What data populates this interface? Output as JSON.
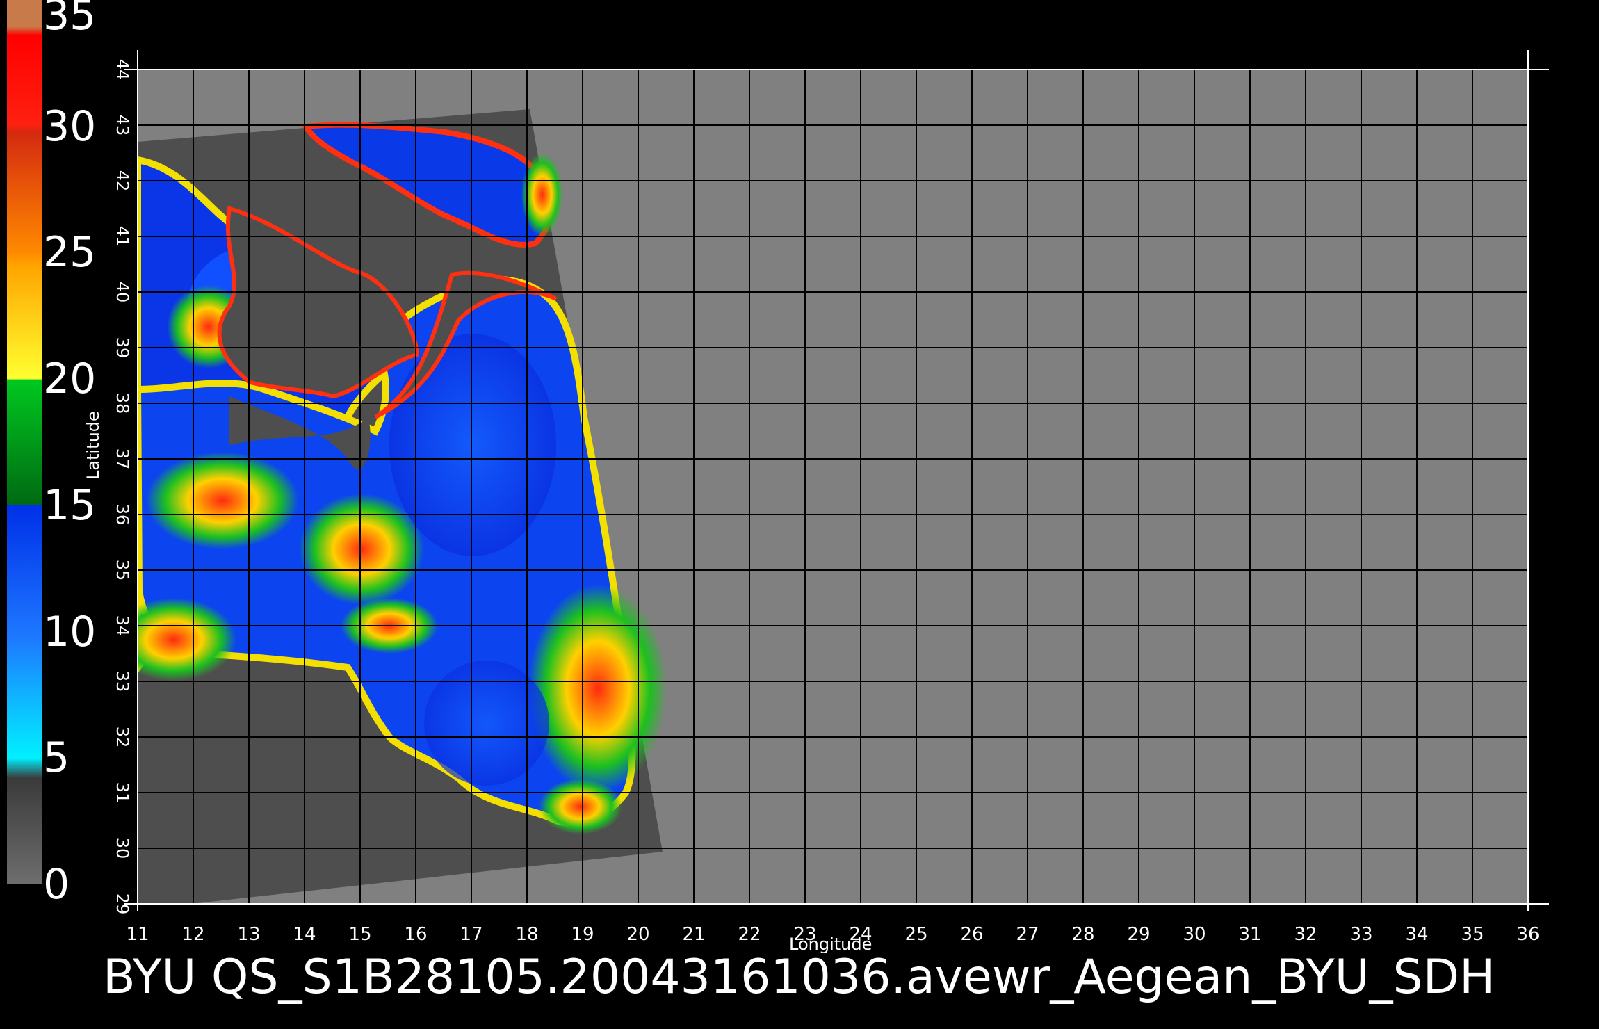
{
  "legend": {
    "ticks": [
      "35",
      "30",
      "25",
      "20",
      "15",
      "10",
      "5",
      "0"
    ],
    "bands": [
      {
        "from": 0,
        "to": 5,
        "colors": [
          "#6e6e6e",
          "#2f2f2f"
        ]
      },
      {
        "from": 5,
        "to": 15,
        "colors": [
          "#00f0ff",
          "#1e78ff",
          "#0030e8"
        ]
      },
      {
        "from": 15,
        "to": 20,
        "colors": [
          "#006a12",
          "#00c820"
        ]
      },
      {
        "from": 20,
        "to": 25,
        "colors": [
          "#ffff30",
          "#ffa400"
        ]
      },
      {
        "from": 25,
        "to": 30,
        "colors": [
          "#ff8a00",
          "#d42a10"
        ]
      },
      {
        "from": 30,
        "to": 35,
        "colors": [
          "#ff2010",
          "#ff0000",
          "#c87a4a"
        ]
      }
    ]
  },
  "map": {
    "lon_range": [
      11,
      36
    ],
    "lat_range": [
      29,
      44
    ],
    "lon_ticks": [
      "11",
      "12",
      "13",
      "14",
      "15",
      "16",
      "17",
      "18",
      "19",
      "20",
      "21",
      "22",
      "23",
      "24",
      "25",
      "26",
      "27",
      "28",
      "29",
      "30",
      "31",
      "32",
      "33",
      "34",
      "35",
      "36"
    ],
    "lat_ticks": [
      "29",
      "30",
      "31",
      "32",
      "33",
      "34",
      "35",
      "36",
      "37",
      "38",
      "39",
      "40",
      "41",
      "42",
      "43",
      "44"
    ],
    "xlabel": "Longitude",
    "ylabel": "Latitude",
    "colors": {
      "background": "#000000",
      "map_fill": "#808080",
      "swath_fill": "#4e4e4e",
      "grid": "#000000",
      "text": "#ffffff"
    }
  },
  "caption": "BYU  QS_S1B28105.20043161036.avewr_Aegean_BYU_SDH"
}
